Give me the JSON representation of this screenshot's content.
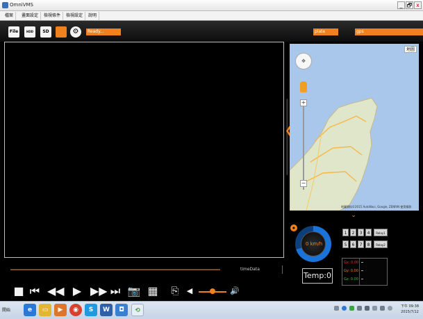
{
  "window": {
    "title": "OmniVMS",
    "minimize": "_",
    "restore": "🗗",
    "close": "x"
  },
  "menu": [
    "檔案",
    "畫面設定",
    "檢視條件",
    "檢視設定",
    "說明"
  ],
  "toolbar": {
    "file_label": "File",
    "hdd_label": "HDD",
    "sd_label": "SD",
    "status_text": "Ready...",
    "plate_label": "plate",
    "gps_label": "gps"
  },
  "map": {
    "type_button": "地圖",
    "credit": "地圖資料©2015 AutoNavi, Google, ZENRIN   使用條款"
  },
  "timeline": {
    "label": "timeData"
  },
  "gauge": {
    "speed_text": "0 km/h",
    "temp_text": "Temp:0"
  },
  "relays": {
    "row1": [
      "1",
      "2",
      "3",
      "4"
    ],
    "row2": [
      "5",
      "6",
      "7",
      "8"
    ],
    "row1_label": "Relay1",
    "row2_label": "Relay2"
  },
  "gsensor": {
    "gx": "Gx: 0.00",
    "gy": "Gy: 0.00",
    "gz": "Gz: 0.00"
  },
  "taskbar": {
    "start_label": "開始",
    "clock_time": "下午 09:38",
    "clock_date": "2015/7/12"
  },
  "colors": {
    "accent": "#f0821e",
    "gauge_blue": "#1a73d9"
  }
}
